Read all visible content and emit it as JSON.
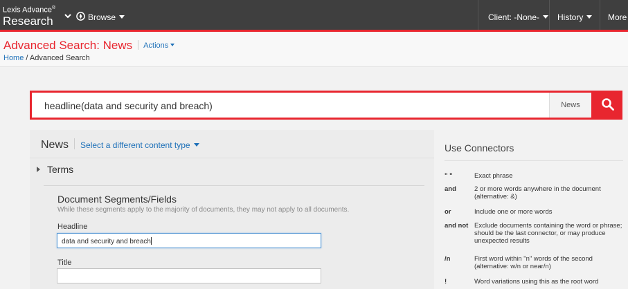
{
  "topbar": {
    "product_line1": "Lexis Advance",
    "product_reg": "®",
    "product_line2": "Research",
    "browse": "Browse",
    "client": "Client: -None-",
    "history": "History",
    "more": "More"
  },
  "header": {
    "title_prefix": "Advanced Search: ",
    "title_topic": "News",
    "actions": "Actions",
    "breadcrumb_home": "Home",
    "breadcrumb_sep": " / ",
    "breadcrumb_current": "Advanced Search"
  },
  "search": {
    "query": "headline(data and security and breach)",
    "scope": "News"
  },
  "left_panel": {
    "content_type": "News",
    "change_link": "Select a different content type",
    "terms": "Terms",
    "segments_title": "Document Segments/Fields",
    "segments_desc": "While these segments apply to the majority of documents, they may not apply to all documents.",
    "headline_label": "Headline",
    "headline_value": "data and security and breach",
    "title_label": "Title",
    "title_value": ""
  },
  "connectors": {
    "title": "Use Connectors",
    "items": [
      {
        "key": "\" \"",
        "desc": "Exact phrase"
      },
      {
        "key": "and",
        "desc": "2 or more words anywhere in the document (alternative: &)"
      },
      {
        "key": "or",
        "desc": "Include one or more words"
      },
      {
        "key": "and not",
        "desc": "Exclude documents containing the word or phrase; should be the last connector, or may produce unexpected results"
      },
      {
        "key": "/n",
        "desc": "First word within \"n\" words of the second (alternative: w/n or near/n)"
      },
      {
        "key": "!",
        "desc": "Word variations using this as the root word"
      }
    ]
  },
  "colors": {
    "accent": "#e8262f",
    "topbar": "#3f3f3f",
    "link": "#1d70b8"
  }
}
